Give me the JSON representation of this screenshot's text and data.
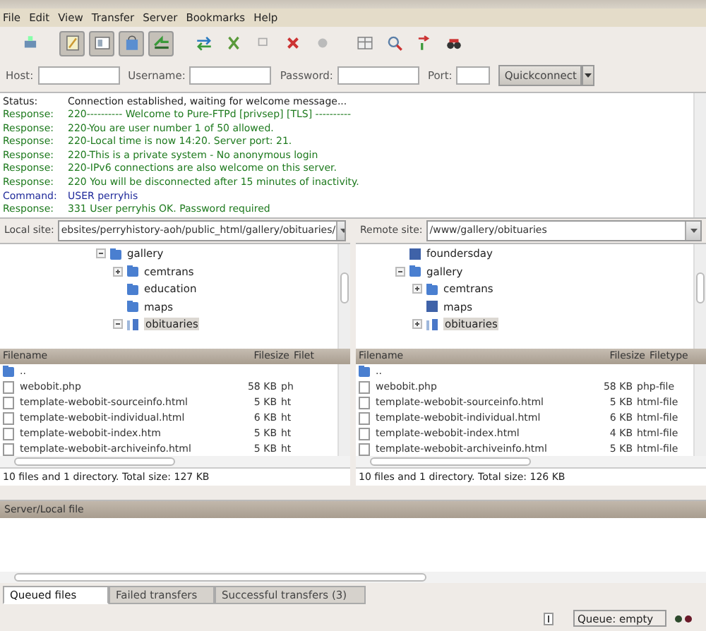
{
  "menu": [
    "File",
    "Edit",
    "View",
    "Transfer",
    "Server",
    "Bookmarks",
    "Help"
  ],
  "toolbar": [
    {
      "pressed": false
    },
    {
      "pressed": true
    },
    {
      "pressed": true
    },
    {
      "pressed": true
    },
    {
      "pressed": true
    },
    {
      "pressed": false
    },
    {
      "pressed": false
    },
    {
      "pressed": false
    },
    {
      "pressed": false
    },
    {
      "pressed": false
    },
    {
      "pressed": false
    },
    {
      "pressed": false
    },
    {
      "pressed": false
    },
    {
      "pressed": false
    }
  ],
  "quickconnect": {
    "fields": [
      {
        "label": "Host:"
      },
      {
        "label": "Username:"
      },
      {
        "label": "Password:"
      },
      {
        "label": "Port:"
      }
    ],
    "button": "Quickconnect"
  },
  "log": [
    {
      "kind": "status",
      "label": "Status:",
      "text": "Connection established, waiting for welcome message..."
    },
    {
      "kind": "response",
      "label": "Response:",
      "text": "220---------- Welcome to Pure-FTPd [privsep] [TLS] ----------"
    },
    {
      "kind": "response",
      "label": "Response:",
      "text": "220-You are user number 1 of 50 allowed."
    },
    {
      "kind": "response",
      "label": "Response:",
      "text": "220-Local time is now 14:20. Server port: 21."
    },
    {
      "kind": "response",
      "label": "Response:",
      "text": "220-This is a private system - No anonymous login"
    },
    {
      "kind": "response",
      "label": "Response:",
      "text": "220-IPv6 connections are also welcome on this server."
    },
    {
      "kind": "response",
      "label": "Response:",
      "text": "220 You will be disconnected after 15 minutes of inactivity."
    },
    {
      "kind": "command",
      "label": "Command:",
      "text": "USER perryhis"
    },
    {
      "kind": "response",
      "label": "Response:",
      "text": "331 User perryhis OK. Password required"
    }
  ],
  "panes": [
    {
      "site_label": "Local site:",
      "path": "ebsites/perryhistory-aoh/public_html/gallery/obituaries/",
      "tree": [
        {
          "label": "gallery",
          "kind": "folder",
          "expanded": true,
          "selected": false,
          "children": [
            {
              "label": "cemtrans",
              "kind": "folder",
              "expanded": false,
              "selected": false
            },
            {
              "label": "education",
              "kind": "folder",
              "selected": false
            },
            {
              "label": "maps",
              "kind": "folder",
              "selected": false
            },
            {
              "label": "obituaries",
              "kind": "open",
              "expanded": true,
              "selected": true
            }
          ]
        }
      ],
      "columns": [
        "Filename",
        "Filesize",
        "Filet"
      ],
      "files": [
        {
          "kind": "folder",
          "name": ".."
        },
        {
          "kind": "file",
          "name": "webobit.php",
          "size": "58 KB",
          "type": "ph"
        },
        {
          "kind": "file",
          "name": "template-webobit-sourceinfo.html",
          "size": "5 KB",
          "type": "ht"
        },
        {
          "kind": "file",
          "name": "template-webobit-individual.html",
          "size": "6 KB",
          "type": "ht"
        },
        {
          "kind": "file",
          "name": "template-webobit-index.htm",
          "size": "5 KB",
          "type": "ht"
        },
        {
          "kind": "file",
          "name": "template-webobit-archiveinfo.html",
          "size": "5 KB",
          "type": "ht"
        }
      ],
      "status": "10 files and 1 directory. Total size: 127 KB"
    },
    {
      "site_label": "Remote site:",
      "path": "/www/gallery/obituaries",
      "tree": [
        {
          "label": "foundersday",
          "kind": "unknown",
          "selected": false
        },
        {
          "label": "gallery",
          "kind": "folder",
          "expanded": true,
          "selected": false,
          "children": [
            {
              "label": "cemtrans",
              "kind": "folder",
              "expanded": false,
              "selected": false
            },
            {
              "label": "maps",
              "kind": "unknown",
              "selected": false
            },
            {
              "label": "obituaries",
              "kind": "open",
              "expanded": false,
              "selected": true
            }
          ]
        }
      ],
      "columns": [
        "Filename",
        "Filesize",
        "Filetype"
      ],
      "files": [
        {
          "kind": "folder",
          "name": ".."
        },
        {
          "kind": "file",
          "name": "webobit.php",
          "size": "58 KB",
          "type": "php-file"
        },
        {
          "kind": "file",
          "name": "template-webobit-sourceinfo.html",
          "size": "5 KB",
          "type": "html-file"
        },
        {
          "kind": "file",
          "name": "template-webobit-individual.html",
          "size": "6 KB",
          "type": "html-file"
        },
        {
          "kind": "file",
          "name": "template-webobit-index.html",
          "size": "4 KB",
          "type": "html-file"
        },
        {
          "kind": "file",
          "name": "template-webobit-archiveinfo.html",
          "size": "5 KB",
          "type": "html-file"
        }
      ],
      "status": "10 files and 1 directory. Total size: 126 KB"
    }
  ],
  "queue": {
    "column": "Server/Local file",
    "tabs": [
      {
        "label": "Queued files",
        "selected": true
      },
      {
        "label": "Failed transfers",
        "selected": false
      },
      {
        "label": "Successful transfers (3)",
        "selected": false
      }
    ]
  },
  "status_bar": {
    "queue": "Queue: empty"
  }
}
